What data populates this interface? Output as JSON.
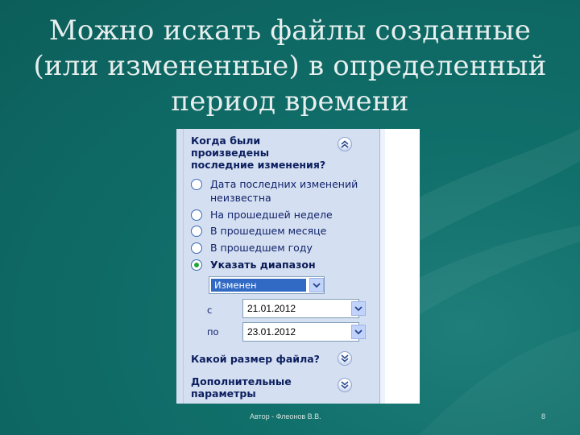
{
  "slide": {
    "title_lines": [
      "Можно искать файлы созданные",
      "(или измененные) в определенный",
      "период времени"
    ],
    "footer": "Автор - Флеонов В.В.",
    "page_number": "8"
  },
  "search_pane": {
    "when_header_lines": [
      "Когда были",
      "произведены",
      "последние изменения?"
    ],
    "when_header_button_icon": "double-chevron-up-icon",
    "options": [
      {
        "label": "Дата последних изменений неизвестна",
        "selected": false
      },
      {
        "label": "На прошедшей неделе",
        "selected": false
      },
      {
        "label": "В прошедшем месяце",
        "selected": false
      },
      {
        "label": "В прошедшем году",
        "selected": false
      },
      {
        "label": "Указать диапазон",
        "selected": true
      }
    ],
    "date_type_select": {
      "value": "Изменен",
      "icon": "chevron-down-icon"
    },
    "from_label": "с",
    "from_date": "21.01.2012",
    "to_label": "по",
    "to_date": "23.01.2012",
    "size_header": "Какой размер файла?",
    "size_header_button_icon": "double-chevron-down-icon",
    "advanced_header_lines": [
      "Дополнительные",
      "параметры"
    ],
    "advanced_header_button_icon": "double-chevron-down-icon"
  },
  "colors": {
    "slide_background": "#0f6a66",
    "title_text": "#e7efee",
    "pane_background": "#d5dff2",
    "selection_blue": "#316ac5",
    "selected_radio": "#23a53d"
  }
}
